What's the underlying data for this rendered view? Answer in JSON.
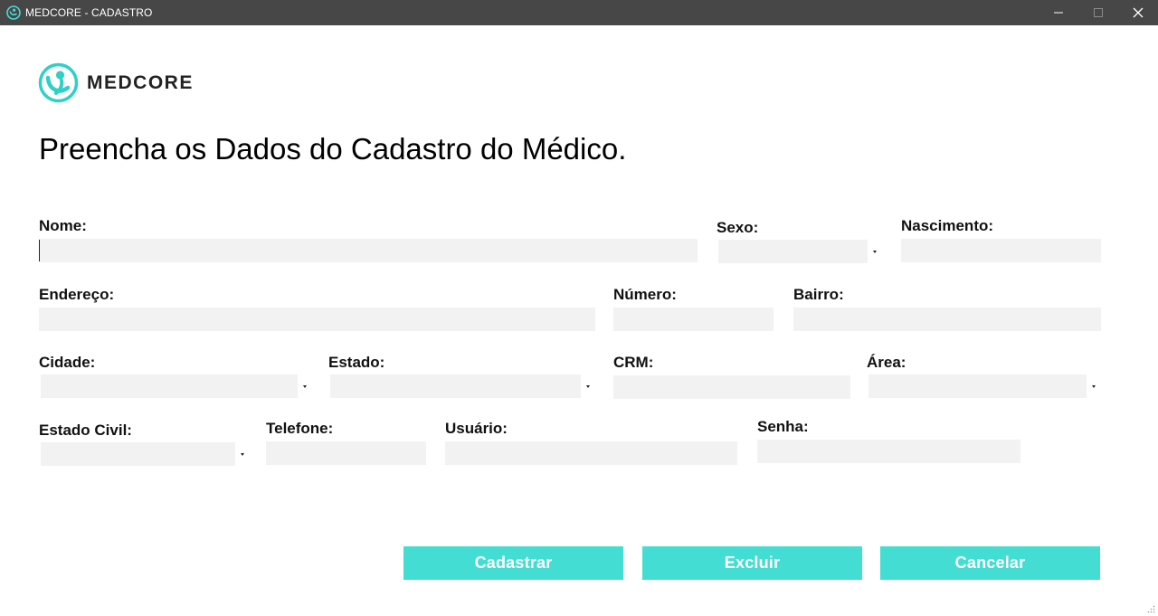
{
  "window": {
    "title": "MEDCORE - CADASTRO",
    "icons": {
      "app": "medcore-logo-icon",
      "minimize": "minimize-icon",
      "maximize": "maximize-icon",
      "close": "close-icon"
    }
  },
  "brand": {
    "name": "MEDCORE",
    "accent": "#44ddd3"
  },
  "heading": "Preencha os Dados do Cadastro do Médico.",
  "form": {
    "nome": {
      "label": "Nome:",
      "value": ""
    },
    "sexo": {
      "label": "Sexo:",
      "value": ""
    },
    "nascimento": {
      "label": "Nascimento:",
      "value": ""
    },
    "endereco": {
      "label": "Endereço:",
      "value": ""
    },
    "numero": {
      "label": "Número:",
      "value": ""
    },
    "bairro": {
      "label": "Bairro:",
      "value": ""
    },
    "cidade": {
      "label": "Cidade:",
      "value": ""
    },
    "estado": {
      "label": "Estado:",
      "value": ""
    },
    "crm": {
      "label": "CRM:",
      "value": ""
    },
    "area": {
      "label": "Área:",
      "value": ""
    },
    "estado_civil": {
      "label": "Estado Civil:",
      "value": ""
    },
    "telefone": {
      "label": "Telefone:",
      "value": ""
    },
    "usuario": {
      "label": "Usuário:",
      "value": ""
    },
    "senha": {
      "label": "Senha:",
      "value": ""
    }
  },
  "buttons": {
    "cadastrar": "Cadastrar",
    "excluir": "Excluir",
    "cancelar": "Cancelar"
  },
  "colors": {
    "titlebar": "#474747",
    "field": "#f2f2f2",
    "button": "#44ddd3"
  }
}
